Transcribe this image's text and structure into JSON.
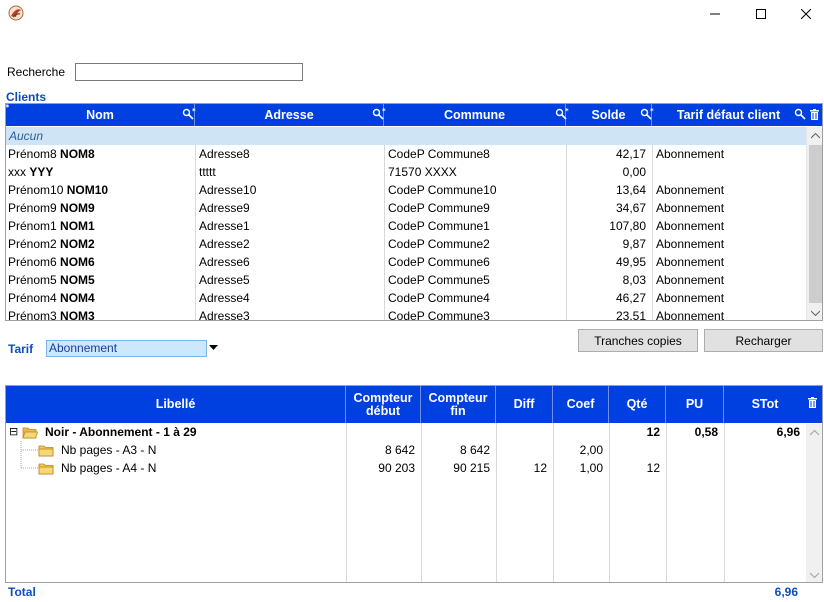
{
  "window": {
    "icon": "app-logo-icon"
  },
  "search": {
    "label": "Recherche",
    "value": "",
    "placeholder": ""
  },
  "clients": {
    "section_label": "Clients",
    "columns": [
      "Nom",
      "Adresse",
      "Commune",
      "Solde",
      "Tarif défaut client"
    ],
    "none_row": "Aucun",
    "rows": [
      {
        "prenom": "Prénom8",
        "nom": "NOM8",
        "adresse": "Adresse8",
        "commune": "CodeP Commune8",
        "solde": "42,17",
        "tarif": "Abonnement"
      },
      {
        "prenom": "xxx",
        "nom": "YYY",
        "adresse": "ttttt",
        "commune": "71570 XXXX",
        "solde": "0,00",
        "tarif": ""
      },
      {
        "prenom": "Prénom10",
        "nom": "NOM10",
        "adresse": "Adresse10",
        "commune": "CodeP Commune10",
        "solde": "13,64",
        "tarif": "Abonnement"
      },
      {
        "prenom": "Prénom9",
        "nom": "NOM9",
        "adresse": "Adresse9",
        "commune": "CodeP Commune9",
        "solde": "34,67",
        "tarif": "Abonnement"
      },
      {
        "prenom": "Prénom1",
        "nom": "NOM1",
        "adresse": "Adresse1",
        "commune": "CodeP Commune1",
        "solde": "107,80",
        "tarif": "Abonnement"
      },
      {
        "prenom": "Prénom2",
        "nom": "NOM2",
        "adresse": "Adresse2",
        "commune": "CodeP Commune2",
        "solde": "9,87",
        "tarif": "Abonnement"
      },
      {
        "prenom": "Prénom6",
        "nom": "NOM6",
        "adresse": "Adresse6",
        "commune": "CodeP Commune6",
        "solde": "49,95",
        "tarif": "Abonnement"
      },
      {
        "prenom": "Prénom5",
        "nom": "NOM5",
        "adresse": "Adresse5",
        "commune": "CodeP Commune5",
        "solde": "8,03",
        "tarif": "Abonnement"
      },
      {
        "prenom": "Prénom4",
        "nom": "NOM4",
        "adresse": "Adresse4",
        "commune": "CodeP Commune4",
        "solde": "46,27",
        "tarif": "Abonnement"
      },
      {
        "prenom": "Prénom3",
        "nom": "NOM3",
        "adresse": "Adresse3",
        "commune": "CodeP Commune3",
        "solde": "23,51",
        "tarif": "Abonnement"
      }
    ]
  },
  "tarif": {
    "label": "Tarif",
    "selected": "Abonnement"
  },
  "buttons": {
    "tranches": "Tranches copies",
    "recharger": "Recharger"
  },
  "detail": {
    "columns": {
      "libelle": "Libellé",
      "compteur_debut": [
        "Compteur",
        "début"
      ],
      "compteur_fin": [
        "Compteur",
        "fin"
      ],
      "diff": "Diff",
      "coef": "Coef",
      "qte": "Qté",
      "pu": "PU",
      "stot": "STot"
    },
    "group": {
      "expander": "⊟",
      "label": "Noir - Abonnement - 1 à 29",
      "qte": "12",
      "pu": "0,58",
      "stot": "6,96"
    },
    "items": [
      {
        "label": "Nb pages - A3 - N",
        "debut": "8 642",
        "fin": "8 642",
        "diff": "",
        "coef": "2,00",
        "qte": ""
      },
      {
        "label": "Nb pages - A4 - N",
        "debut": "90 203",
        "fin": "90 215",
        "diff": "12",
        "coef": "1,00",
        "qte": "12"
      }
    ]
  },
  "total": {
    "label": "Total",
    "value": "6,96"
  },
  "colors": {
    "header_blue": "#0040e0",
    "label_blue": "#0b4dc1",
    "selected_row": "#cfe4f5"
  }
}
